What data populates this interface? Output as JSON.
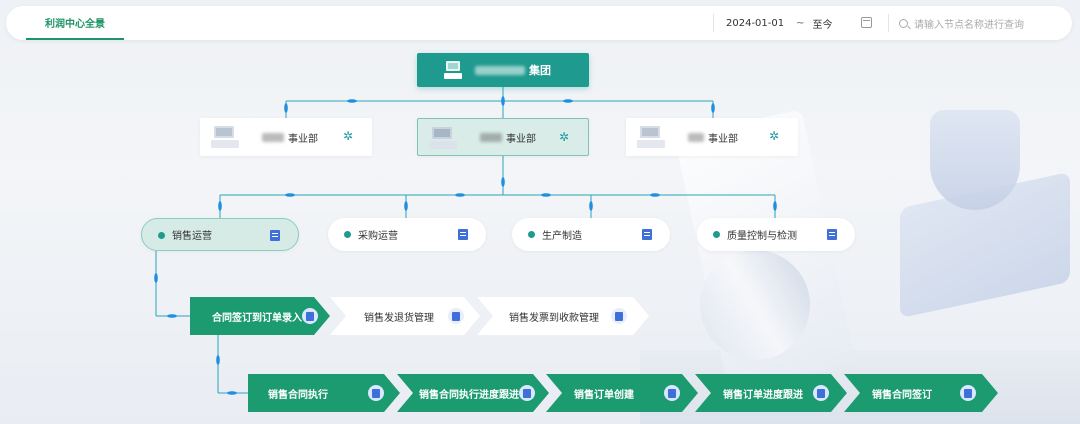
{
  "topbar": {
    "tab_label": "利润中心全景",
    "date_from": "2024-01-01",
    "date_sep": "~",
    "date_to": "至今",
    "search_placeholder": "请输入节点名称进行查询"
  },
  "group": {
    "name_suffix": "集团"
  },
  "business_units": [
    {
      "name_suffix": "事业部",
      "active": false
    },
    {
      "name_suffix": "事业部",
      "active": true
    },
    {
      "name_suffix": "事业部",
      "active": false
    }
  ],
  "domains": [
    {
      "label": "销售运营",
      "active": true
    },
    {
      "label": "采购运营",
      "active": false
    },
    {
      "label": "生产制造",
      "active": false
    },
    {
      "label": "质量控制与检测",
      "active": false
    }
  ],
  "process_level1": [
    {
      "label": "合同签订到订单录入",
      "style": "green"
    },
    {
      "label": "销售发退货管理",
      "style": "white"
    },
    {
      "label": "销售发票到收款管理",
      "style": "white"
    }
  ],
  "process_level2": [
    {
      "label": "销售合同执行",
      "style": "green"
    },
    {
      "label": "销售合同执行进度跟进",
      "style": "green"
    },
    {
      "label": "销售订单创建",
      "style": "green"
    },
    {
      "label": "销售订单进度跟进",
      "style": "green"
    },
    {
      "label": "销售合同签订",
      "style": "green"
    }
  ],
  "colors": {
    "primary_green": "#1b9b6f",
    "teal_group": "#1f9a8f",
    "connector": "#2aa6b8",
    "doc_icon_blue": "#3f6fd8"
  }
}
